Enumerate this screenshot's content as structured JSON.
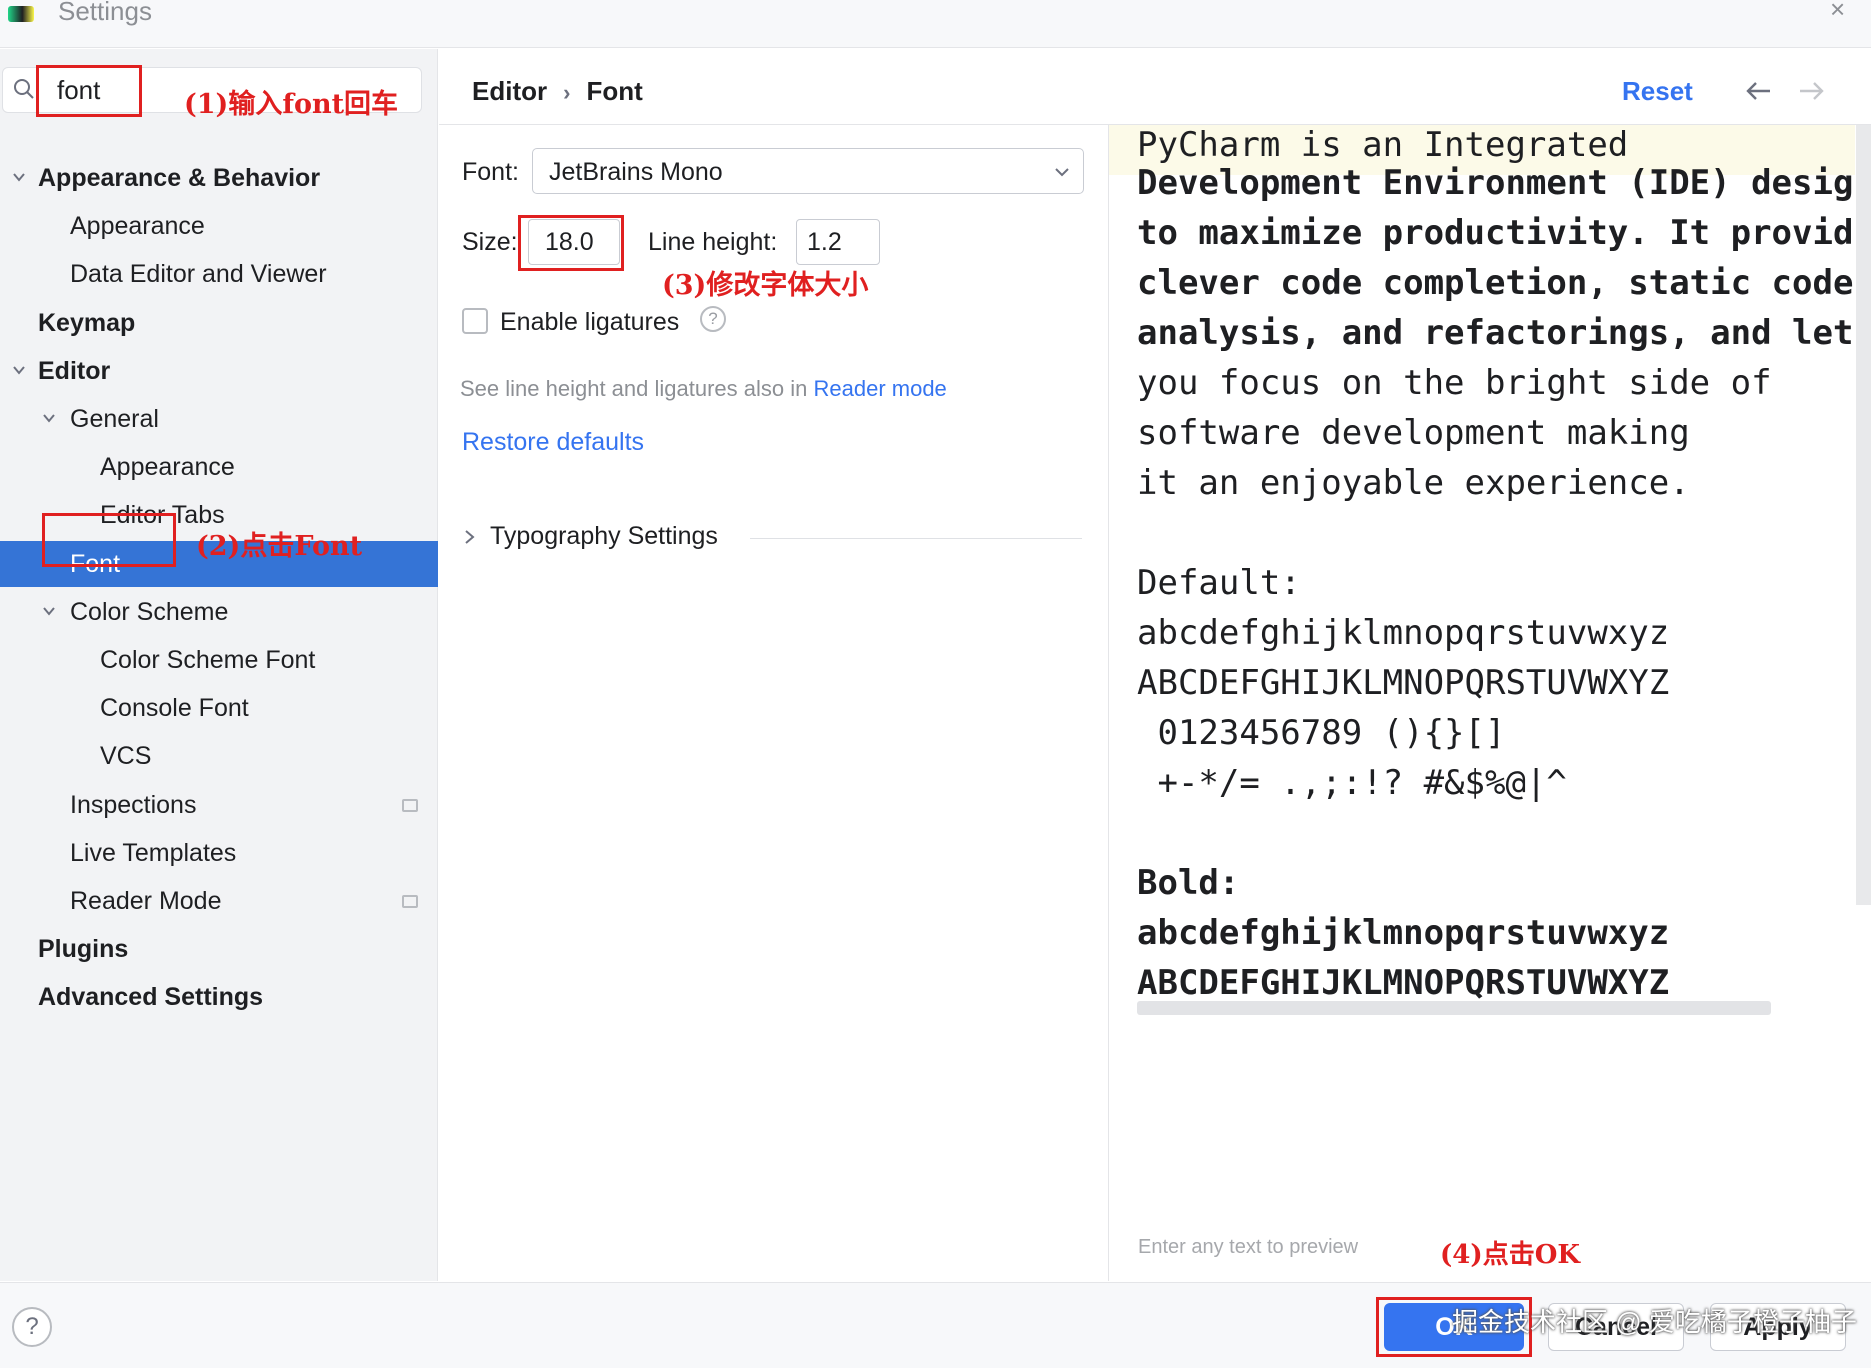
{
  "window": {
    "title": "Settings"
  },
  "search": {
    "value": "font"
  },
  "annotations": {
    "step1": "(1)输入font回车",
    "step2": "(2)点击Font",
    "step3": "(3)修改字体大小",
    "step4": "(4)点击OK"
  },
  "sidebar": {
    "items": [
      {
        "label": "Appearance & Behavior",
        "level": 0,
        "expanded": true,
        "bold": true
      },
      {
        "label": "Appearance",
        "level": 1
      },
      {
        "label": "Data Editor and Viewer",
        "level": 1
      },
      {
        "label": "Keymap",
        "level": 0,
        "bold": true
      },
      {
        "label": "Editor",
        "level": 0,
        "expanded": true,
        "bold": true
      },
      {
        "label": "General",
        "level": 1,
        "expanded": true
      },
      {
        "label": "Appearance",
        "level": 2
      },
      {
        "label": "Editor Tabs",
        "level": 2
      },
      {
        "label": "Font",
        "level": 1,
        "selected": true
      },
      {
        "label": "Color Scheme",
        "level": 1,
        "expanded": true
      },
      {
        "label": "Color Scheme Font",
        "level": 2
      },
      {
        "label": "Console Font",
        "level": 2
      },
      {
        "label": "VCS",
        "level": 2
      },
      {
        "label": "Inspections",
        "level": 1,
        "badge": true
      },
      {
        "label": "Live Templates",
        "level": 1
      },
      {
        "label": "Reader Mode",
        "level": 1,
        "badge": true
      },
      {
        "label": "Plugins",
        "level": 0,
        "bold": true
      },
      {
        "label": "Advanced Settings",
        "level": 0,
        "bold": true
      }
    ]
  },
  "header": {
    "breadcrumb": [
      "Editor",
      "Font"
    ],
    "reset_label": "Reset"
  },
  "settings": {
    "font_label": "Font:",
    "font_value": "JetBrains Mono",
    "size_label": "Size:",
    "size_value": "18.0",
    "line_height_label": "Line height:",
    "line_height_value": "1.2",
    "ligatures_label": "Enable ligatures",
    "ligatures_checked": false,
    "hint_prefix": "See line height and ligatures also in",
    "hint_link": "Reader mode",
    "restore_label": "Restore defaults",
    "typography_label": "Typography Settings"
  },
  "preview": {
    "lines": [
      "PyCharm is an Integrated",
      "Development Environment (IDE) designed",
      "to maximize productivity. It provides",
      "clever code completion, static code",
      "analysis, and refactorings, and lets",
      "you focus on the bright side of",
      "software development making",
      "it an enjoyable experience.",
      "Default:",
      "abcdefghijklmnopqrstuvwxyz",
      "ABCDEFGHIJKLMNOPQRSTUVWXYZ",
      " 0123456789 (){}[]",
      " +-*/= .,;:!? #&$%@|^",
      "Bold:",
      "abcdefghijklmnopqrstuvwxyz",
      "ABCDEFGHIJKLMNOPQRSTUVWXYZ"
    ],
    "placeholder": "Enter any text to preview"
  },
  "footer": {
    "help": "?",
    "ok_label": "OK",
    "cancel_label": "Cancel",
    "apply_label": "Apply"
  },
  "watermark": "掘金技术社区 @ 爱吃橘子橙子柚子",
  "colors": {
    "accent": "#3574f0",
    "selection": "#3574d6",
    "annotation": "#e02020",
    "sidebar_bg": "#f2f3f5"
  }
}
